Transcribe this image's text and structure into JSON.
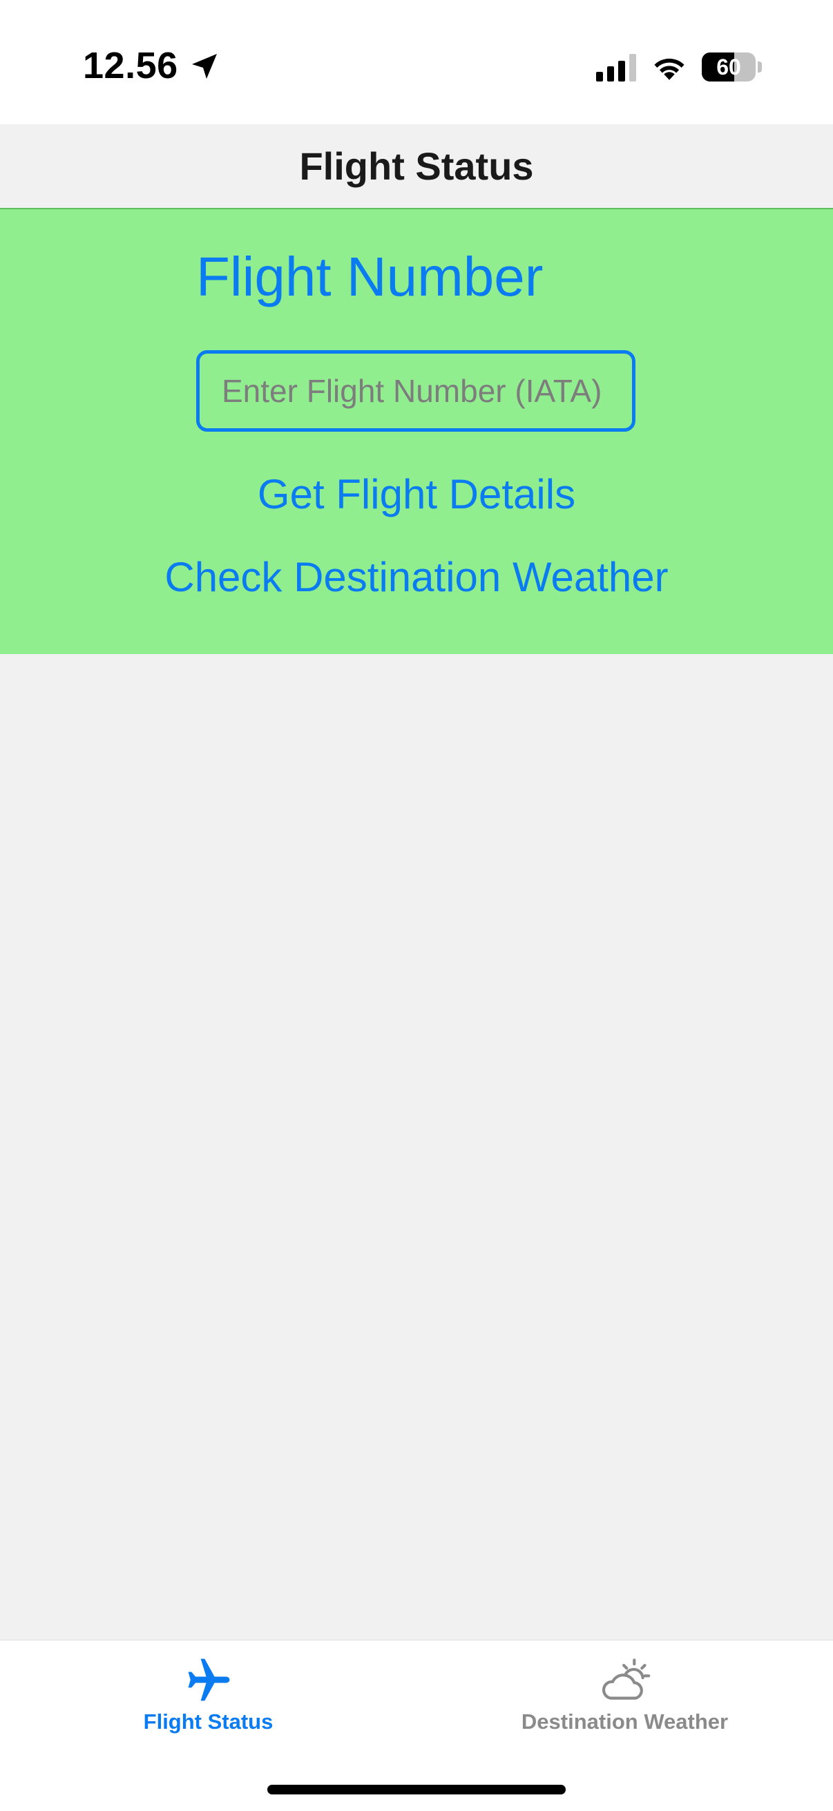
{
  "status_bar": {
    "time": "12.56",
    "battery_level": "60",
    "battery_fraction": 0.6,
    "icons": [
      "location-arrow-icon",
      "cellular-signal-icon",
      "wifi-icon",
      "battery-icon"
    ]
  },
  "nav": {
    "title": "Flight Status"
  },
  "form": {
    "heading": "Flight Number",
    "input_value": "",
    "input_placeholder": "Enter Flight Number (IATA)",
    "get_details_label": "Get Flight Details",
    "check_weather_label": "Check Destination Weather"
  },
  "tab_bar": {
    "tabs": [
      {
        "label": "Flight Status",
        "icon": "airplane-icon",
        "selected": true
      },
      {
        "label": "Destination Weather",
        "icon": "cloud-sun-icon",
        "selected": false
      }
    ]
  },
  "colors": {
    "accent": "#0a7bf0",
    "panel_background": "#90ee8f",
    "content_background": "#f1f1f1",
    "inactive_tab": "#8a8a8a"
  }
}
